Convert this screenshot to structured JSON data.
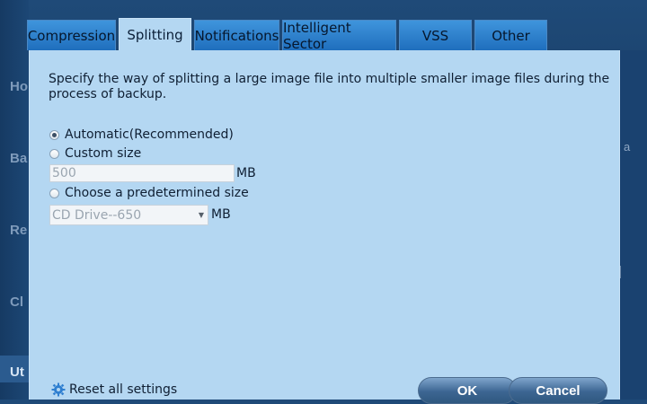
{
  "background_nav": [
    {
      "label": "Ho",
      "top": 0
    },
    {
      "label": "Ba",
      "top": 0
    },
    {
      "label": "Re",
      "top": 0
    },
    {
      "label": "Cl",
      "top": 0
    },
    {
      "label": "Ut",
      "top": 0
    }
  ],
  "background_right_text": "a",
  "tabs": [
    {
      "label": "Compression"
    },
    {
      "label": "Splitting"
    },
    {
      "label": "Notifications"
    },
    {
      "label": "Intelligent Sector"
    },
    {
      "label": "VSS"
    },
    {
      "label": "Other"
    }
  ],
  "panel": {
    "description": "Specify the way of splitting a large image file into multiple smaller image files during the process of backup.",
    "options": {
      "automatic": {
        "label": "Automatic(Recommended)",
        "checked": true
      },
      "custom": {
        "label": "Custom size",
        "checked": false
      },
      "predetermined": {
        "label": "Choose a predetermined size",
        "checked": false
      }
    },
    "custom_size_value": "500",
    "custom_size_unit": "MB",
    "predetermined_value": "CD Drive--650",
    "predetermined_unit": "MB"
  },
  "footer": {
    "reset_label": "Reset all settings",
    "ok_label": "OK",
    "cancel_label": "Cancel"
  },
  "colors": {
    "panel_bg": "#b4d7f2",
    "tab_bg": "#2f80cc",
    "window_bg": "#1a4270"
  }
}
